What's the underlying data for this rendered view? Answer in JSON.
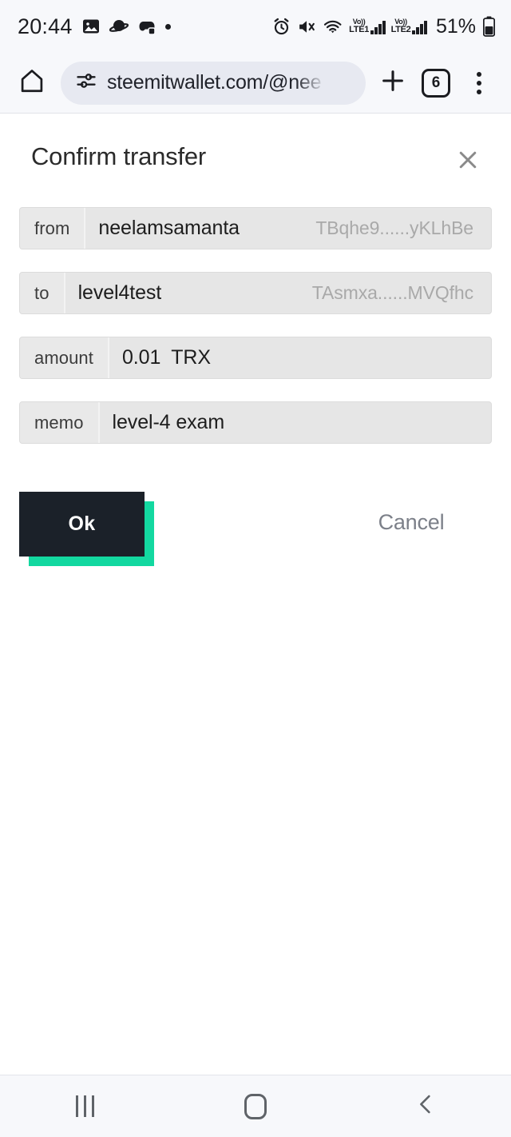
{
  "status_bar": {
    "clock": "20:44",
    "battery_percent": "51%",
    "left_icons": [
      "photo-icon",
      "planet-icon",
      "gamepad-icon",
      "dot-icon"
    ],
    "right_icons": [
      "alarm-icon",
      "mute-icon",
      "wifi-icon",
      "signal-icon",
      "battery-icon"
    ],
    "sim1": {
      "volte": "Vo))",
      "network": "LTE1"
    },
    "sim2": {
      "volte": "Vo))",
      "network": "LTE2"
    }
  },
  "browser": {
    "home_icon": "home-icon",
    "site_settings_icon": "tune-icon",
    "url": "steemitwallet.com/@nee",
    "new_tab_icon": "plus-icon",
    "tab_count": "6",
    "menu_icon": "kebab-menu-icon"
  },
  "dialog": {
    "title": "Confirm transfer",
    "close_icon": "close-icon",
    "rows": [
      {
        "label": "from",
        "value": "neelamsamanta",
        "address": "TBqhe9......yKLhBe"
      },
      {
        "label": "to",
        "value": "level4test",
        "address": "TAsmxa......MVQfhc"
      },
      {
        "label": "amount",
        "value": "0.01",
        "unit": "TRX"
      },
      {
        "label": "memo",
        "value": "level-4 exam"
      }
    ],
    "confirm_label": "Ok",
    "cancel_label": "Cancel"
  },
  "colors": {
    "accent_teal": "#13d8a0",
    "button_dark": "#1b2129",
    "field_bg": "#e6e6e6",
    "muted_text": "#a9a9a9"
  },
  "nav_bar": {
    "recents_icon": "recents-icon",
    "home_icon": "home-button-icon",
    "back_icon": "back-chevron-icon"
  }
}
